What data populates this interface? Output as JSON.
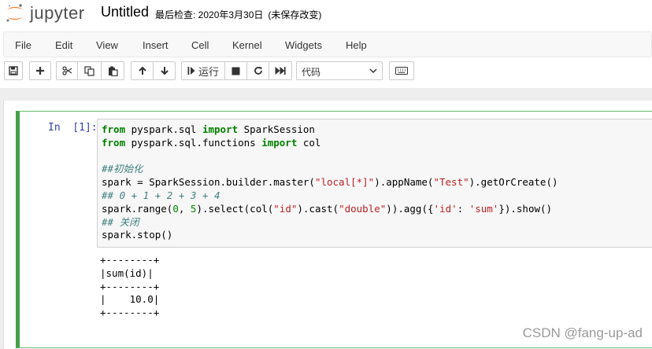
{
  "header": {
    "logo_text": "jupyter",
    "notebook_name": "Untitled",
    "checkpoint_label": "最后检查: 2020年3月30日",
    "save_status": "(未保存改变)"
  },
  "menubar": {
    "items": [
      "File",
      "Edit",
      "View",
      "Insert",
      "Cell",
      "Kernel",
      "Widgets",
      "Help"
    ]
  },
  "toolbar": {
    "run_label": "运行",
    "cell_type": "代码",
    "icons": [
      "save-icon",
      "plus-icon",
      "cut-icon",
      "copy-icon",
      "paste-icon",
      "arrow-up-icon",
      "arrow-down-icon",
      "step-forward-icon",
      "stop-icon",
      "restart-icon",
      "fast-forward-icon",
      "keyboard-icon"
    ]
  },
  "cell": {
    "prompt": "In  [1]:",
    "code_lines": [
      "from pyspark.sql import SparkSession",
      "from pyspark.sql.functions import col",
      "",
      "##初始化",
      "spark = SparkSession.builder.master(\"local[*]\").appName(\"Test\").getOrCreate()",
      "## 0 + 1 + 2 + 3 + 4",
      "spark.range(0, 5).select(col(\"id\").cast(\"double\")).agg({'id': 'sum'}).show()",
      "## 关闭",
      "spark.stop()"
    ],
    "output_lines": [
      "+--------+",
      "|sum(id)|",
      "+--------+",
      "|    10.0|",
      "+--------+"
    ]
  },
  "watermark": "CSDN @fang-up-ad",
  "colors": {
    "cell_border": "#42a048",
    "prompt": "#303f9f",
    "keyword": "#008000",
    "string": "#ba2121",
    "comment": "#408080"
  }
}
